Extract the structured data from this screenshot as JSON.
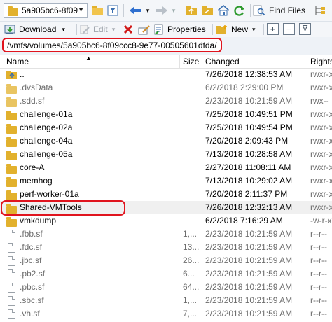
{
  "toolbar": {
    "session_combo": "5a905bc6-8f09",
    "find_files_label": "Find Files",
    "download_label": "Download",
    "edit_label": "Edit",
    "properties_label": "Properties",
    "new_label": "New",
    "new_dropdown_glyph": "▾",
    "download_dropdown_glyph": "▾",
    "plus_glyph": "+",
    "minus_glyph": "−",
    "filter_glyph": "∇"
  },
  "path": {
    "value": "/vmfs/volumes/5a905bc6-8f09ccc8-9e77-00505601dfda/"
  },
  "columns": {
    "name": "Name",
    "size": "Size",
    "changed": "Changed",
    "rights": "Rights"
  },
  "files": [
    {
      "name": "..",
      "size": "",
      "changed": "7/26/2018 12:38:53 AM",
      "rights": "rwxr-x"
    },
    {
      "name": ".dvsData",
      "size": "",
      "changed": "6/2/2018 2:29:00 PM",
      "rights": "rwxr-x"
    },
    {
      "name": ".sdd.sf",
      "size": "",
      "changed": "2/23/2018 10:21:59 AM",
      "rights": "rwx--"
    },
    {
      "name": "challenge-01a",
      "size": "",
      "changed": "7/25/2018 10:49:51 PM",
      "rights": "rwxr-x"
    },
    {
      "name": "challenge-02a",
      "size": "",
      "changed": "7/25/2018 10:49:54 PM",
      "rights": "rwxr-x"
    },
    {
      "name": "challenge-04a",
      "size": "",
      "changed": "7/20/2018 2:09:43 PM",
      "rights": "rwxr-x"
    },
    {
      "name": "challenge-05a",
      "size": "",
      "changed": "7/13/2018 10:28:58 AM",
      "rights": "rwxr-x"
    },
    {
      "name": "core-A",
      "size": "",
      "changed": "2/27/2018 11:08:11 AM",
      "rights": "rwxr-x"
    },
    {
      "name": "memhog",
      "size": "",
      "changed": "7/13/2018 10:29:02 AM",
      "rights": "rwxr-x"
    },
    {
      "name": "perf-worker-01a",
      "size": "",
      "changed": "7/20/2018 2:11:37 PM",
      "rights": "rwxr-x"
    },
    {
      "name": "Shared-VMTools",
      "size": "",
      "changed": "7/26/2018 12:32:13 AM",
      "rights": "rwxr-x"
    },
    {
      "name": "vmkdump",
      "size": "",
      "changed": "6/2/2018 7:16:29 AM",
      "rights": "-w-r-x"
    },
    {
      "name": ".fbb.sf",
      "size": "1,...",
      "changed": "2/23/2018 10:21:59 AM",
      "rights": "r--r--"
    },
    {
      "name": ".fdc.sf",
      "size": "13...",
      "changed": "2/23/2018 10:21:59 AM",
      "rights": "r--r--"
    },
    {
      "name": ".jbc.sf",
      "size": "26...",
      "changed": "2/23/2018 10:21:59 AM",
      "rights": "r--r--"
    },
    {
      "name": ".pb2.sf",
      "size": "6...",
      "changed": "2/23/2018 10:21:59 AM",
      "rights": "r--r--"
    },
    {
      "name": ".pbc.sf",
      "size": "64...",
      "changed": "2/23/2018 10:21:59 AM",
      "rights": "r--r--"
    },
    {
      "name": ".sbc.sf",
      "size": "1,...",
      "changed": "2/23/2018 10:21:59 AM",
      "rights": "r--r--"
    },
    {
      "name": ".vh.sf",
      "size": "7,...",
      "changed": "2/23/2018 10:21:59 AM",
      "rights": "r--r--"
    }
  ],
  "colors": {
    "highlight_red": "#e0141e",
    "folder": "#e2b12d",
    "hidden_text": "#6d6d6d"
  }
}
